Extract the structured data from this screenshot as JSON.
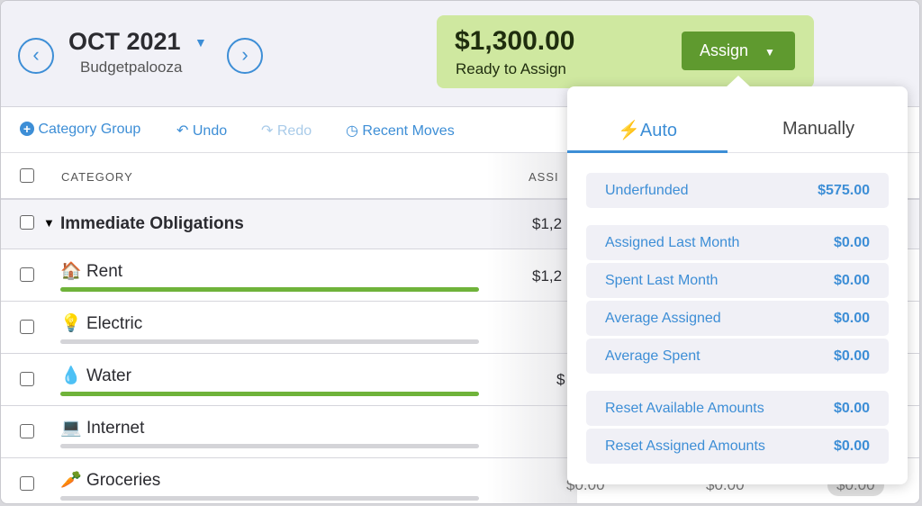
{
  "header": {
    "month": "OCT 2021",
    "budget_name": "Budgetpalooza",
    "prev_icon": "chevron-left-circle",
    "next_icon": "chevron-right-circle"
  },
  "ready": {
    "amount": "$1,300.00",
    "label": "Ready to Assign",
    "assign_button": "Assign",
    "color": "#cfe8a0",
    "button_color": "#5f9a2f"
  },
  "toolbar": {
    "category_group": "Category Group",
    "undo": "Undo",
    "redo": "Redo",
    "recent_moves": "Recent Moves"
  },
  "table": {
    "col_category": "CATEGORY",
    "col_assigned_partial": "ASSI",
    "group": {
      "name": "Immediate Obligations",
      "assigned_partial": "$1,2"
    },
    "rows": [
      {
        "emoji": "🏠",
        "name": "Rent",
        "assigned_partial": "$1,2",
        "progress": 1.0
      },
      {
        "emoji": "💡",
        "name": "Electric",
        "assigned_partial": "",
        "progress": 0
      },
      {
        "emoji": "💧",
        "name": "Water",
        "assigned_partial": "$",
        "progress": 1.0
      },
      {
        "emoji": "💻",
        "name": "Internet",
        "assigned_partial": "",
        "progress": 0
      },
      {
        "emoji": "🥕",
        "name": "Groceries",
        "assigned": "$0.00",
        "activity": "$0.00",
        "available": "$0.00",
        "progress": 0
      }
    ]
  },
  "popover": {
    "tabs": [
      {
        "label": "Auto",
        "icon": "lightning",
        "active": true
      },
      {
        "label": "Manually",
        "active": false
      }
    ],
    "items": [
      {
        "label": "Underfunded",
        "value": "$575.00"
      },
      {
        "label": "Assigned Last Month",
        "value": "$0.00"
      },
      {
        "label": "Spent Last Month",
        "value": "$0.00"
      },
      {
        "label": "Average Assigned",
        "value": "$0.00"
      },
      {
        "label": "Average Spent",
        "value": "$0.00"
      },
      {
        "label": "Reset Available Amounts",
        "value": "$0.00"
      },
      {
        "label": "Reset Assigned Amounts",
        "value": "$0.00"
      }
    ]
  }
}
